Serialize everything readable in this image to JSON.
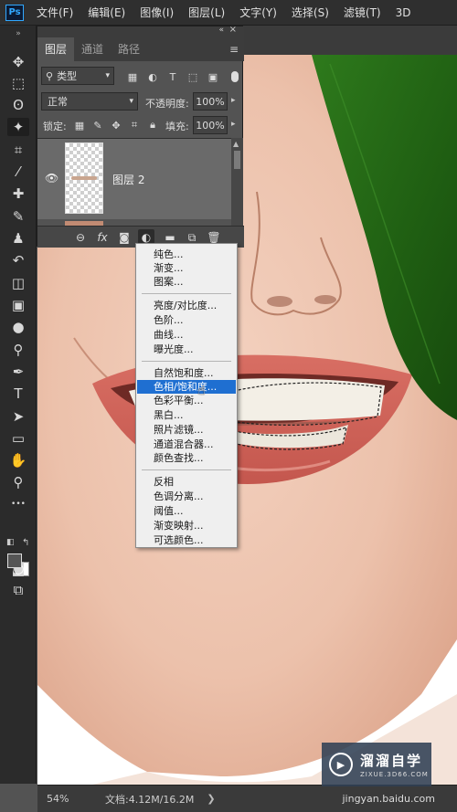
{
  "app": {
    "logo": "Ps"
  },
  "menubar": {
    "items": [
      "文件(F)",
      "编辑(E)",
      "图像(I)",
      "图层(L)",
      "文字(Y)",
      "选择(S)",
      "滤镜(T)",
      "3D"
    ]
  },
  "toolbar": {
    "tools": [
      {
        "name": "move-tool-icon",
        "glyph": "✥"
      },
      {
        "name": "marquee-tool-icon",
        "glyph": "⬚"
      },
      {
        "name": "lasso-tool-icon",
        "glyph": "ʘ"
      },
      {
        "name": "magic-wand-tool-icon",
        "glyph": "✦"
      },
      {
        "name": "crop-tool-icon",
        "glyph": "⌗"
      },
      {
        "name": "eyedropper-tool-icon",
        "glyph": "⁄"
      },
      {
        "name": "healing-brush-tool-icon",
        "glyph": "✚"
      },
      {
        "name": "brush-tool-icon",
        "glyph": "✎"
      },
      {
        "name": "clone-stamp-tool-icon",
        "glyph": "♟"
      },
      {
        "name": "history-brush-tool-icon",
        "glyph": "↶"
      },
      {
        "name": "eraser-tool-icon",
        "glyph": "◫"
      },
      {
        "name": "gradient-tool-icon",
        "glyph": "▣"
      },
      {
        "name": "blur-tool-icon",
        "glyph": "●"
      },
      {
        "name": "dodge-tool-icon",
        "glyph": "⚲"
      },
      {
        "name": "pen-tool-icon",
        "glyph": "✒"
      },
      {
        "name": "type-tool-icon",
        "glyph": "T"
      },
      {
        "name": "path-selection-tool-icon",
        "glyph": "➤"
      },
      {
        "name": "rectangle-tool-icon",
        "glyph": "▭"
      },
      {
        "name": "hand-tool-icon",
        "glyph": "✋"
      },
      {
        "name": "zoom-tool-icon",
        "glyph": "⚲"
      },
      {
        "name": "more-tools-icon",
        "glyph": "•••"
      }
    ],
    "bottom_tools": [
      {
        "name": "quick-mask-icon",
        "glyph": "◙"
      },
      {
        "name": "screen-mode-icon",
        "glyph": "⧉"
      }
    ]
  },
  "layers_panel": {
    "tabs": [
      "图层",
      "通道",
      "路径"
    ],
    "active_tab": "图层",
    "filter_label": "类型",
    "blend_mode": "正常",
    "opacity_label": "不透明度:",
    "opacity_value": "100%",
    "lock_label": "锁定:",
    "fill_label": "填充:",
    "fill_value": "100%",
    "layers": [
      {
        "name": "图层 2",
        "visible": true
      }
    ]
  },
  "adjustment_menu": {
    "groups": [
      [
        "纯色...",
        "渐变...",
        "图案..."
      ],
      [
        "亮度/对比度...",
        "色阶...",
        "曲线...",
        "曝光度..."
      ],
      [
        "自然饱和度...",
        "色相/饱和度...",
        "色彩平衡...",
        "黑白...",
        "照片滤镜...",
        "通道混合器...",
        "颜色查找..."
      ],
      [
        "反相",
        "色调分离...",
        "阈值...",
        "渐变映射...",
        "可选颜色..."
      ]
    ],
    "selected": "色相/饱和度..."
  },
  "statusbar": {
    "zoom": "54%",
    "doc_size": "文档:4.12M/16.2M",
    "arrow": "❯"
  },
  "watermark": {
    "cn": "溜溜自学",
    "en": "ZIXUE.3D66.COM",
    "url": "jingyan.baidu.com"
  },
  "colors": {
    "selection_highlight": "#1f6fd1",
    "menu_bg": "#efefef",
    "panel_bg": "#535353",
    "chrome_dark": "#2f2f2f"
  }
}
